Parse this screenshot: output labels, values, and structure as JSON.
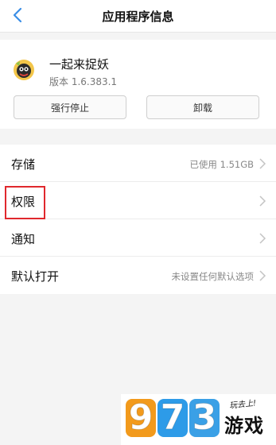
{
  "header": {
    "title": "应用程序信息",
    "back_icon": "chevron-left-icon"
  },
  "app": {
    "name": "一起来捉妖",
    "version": "版本 1.6.383.1",
    "force_stop_label": "强行停止",
    "uninstall_label": "卸载"
  },
  "list": {
    "items": [
      {
        "label": "存储",
        "value": "已使用 1.51GB"
      },
      {
        "label": "权限",
        "value": ""
      },
      {
        "label": "通知",
        "value": ""
      },
      {
        "label": "默认打开",
        "value": "未设置任何默认选项"
      }
    ]
  },
  "watermark": {
    "digits": [
      "9",
      "7",
      "3"
    ],
    "text": "游戏",
    "slogan": "玩去上!",
    "colors": [
      "#f29a1c",
      "#2d9be8",
      "#3aa0e6"
    ]
  },
  "colors": {
    "accent": "#3a8ee6",
    "highlight": "#e0282d"
  }
}
